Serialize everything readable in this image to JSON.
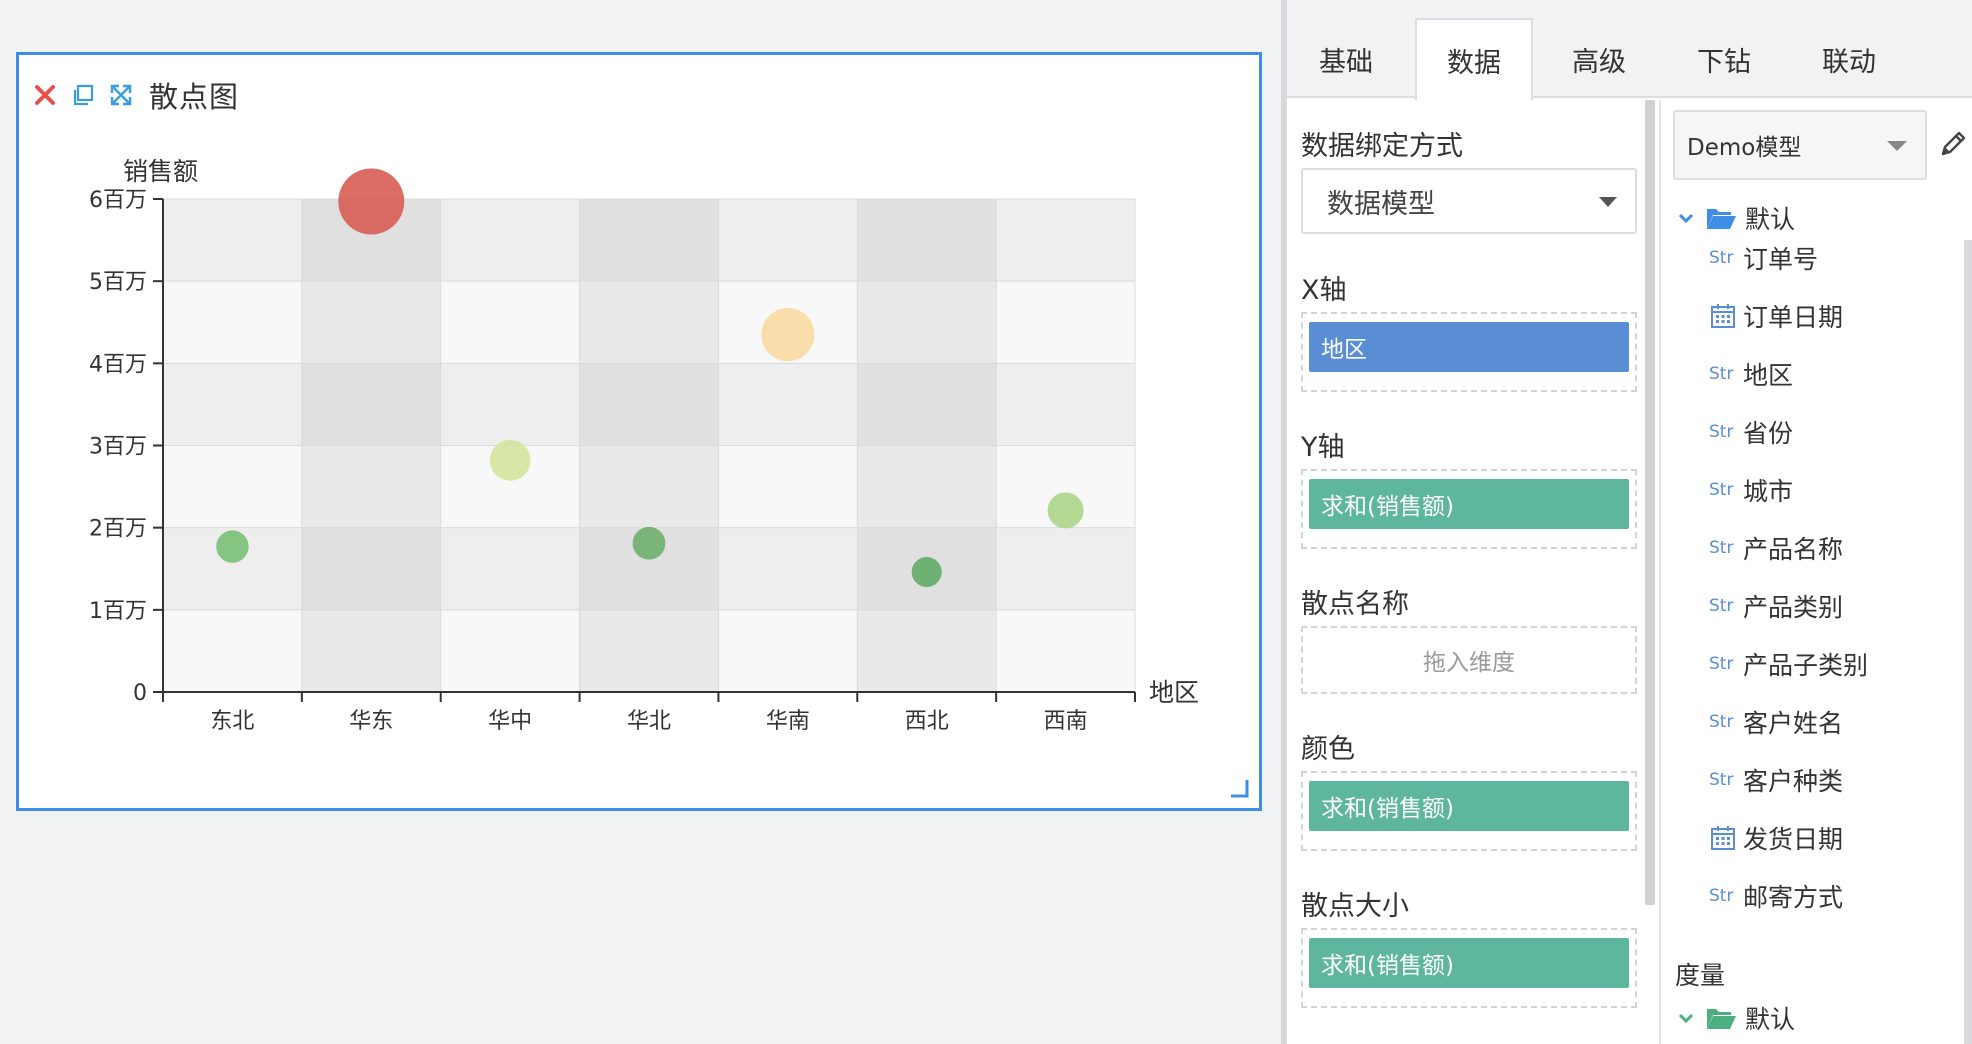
{
  "widget": {
    "title": "散点图",
    "toolbar_icons": [
      "close-icon",
      "copy-icon",
      "expand-icon"
    ]
  },
  "chart_data": {
    "type": "scatter",
    "title": "散点图",
    "xlabel": "地区",
    "ylabel": "销售额",
    "categories": [
      "东北",
      "华东",
      "华中",
      "华北",
      "华南",
      "西北",
      "西南"
    ],
    "values": [
      1770000,
      5970000,
      2820000,
      1810000,
      4350000,
      1460000,
      2210000
    ],
    "colors": [
      "#78be72",
      "#d6594f",
      "#d2e59a",
      "#6aae6a",
      "#f8d9a0",
      "#5ea863",
      "#a8d486"
    ],
    "y_ticks": [
      "0",
      "1百万",
      "2百万",
      "3百万",
      "4百万",
      "5百万",
      "6百万"
    ],
    "ylim": [
      0,
      6000000
    ],
    "size_by_value": true,
    "grid": true
  },
  "tabs": [
    {
      "label": "基础",
      "active": false
    },
    {
      "label": "数据",
      "active": true
    },
    {
      "label": "高级",
      "active": false
    },
    {
      "label": "下钻",
      "active": false
    },
    {
      "label": "联动",
      "active": false
    }
  ],
  "binding": {
    "mode_label": "数据绑定方式",
    "mode_value": "数据模型",
    "x_label": "X轴",
    "x_field": "地区",
    "y_label": "Y轴",
    "y_field": "求和(销售额)",
    "name_label": "散点名称",
    "name_placeholder": "拖入维度",
    "color_label": "颜色",
    "color_field": "求和(销售额)",
    "size_label": "散点大小",
    "size_field": "求和(销售额)"
  },
  "tree": {
    "model": "Demo模型",
    "dim_folder": "默认",
    "dimensions": [
      {
        "type": "Str",
        "label": "订单号"
      },
      {
        "type": "date",
        "label": "订单日期"
      },
      {
        "type": "Str",
        "label": "地区"
      },
      {
        "type": "Str",
        "label": "省份"
      },
      {
        "type": "Str",
        "label": "城市"
      },
      {
        "type": "Str",
        "label": "产品名称"
      },
      {
        "type": "Str",
        "label": "产品类别"
      },
      {
        "type": "Str",
        "label": "产品子类别"
      },
      {
        "type": "Str",
        "label": "客户姓名"
      },
      {
        "type": "Str",
        "label": "客户种类"
      },
      {
        "type": "date",
        "label": "发货日期"
      },
      {
        "type": "Str",
        "label": "邮寄方式"
      }
    ],
    "measure_label": "度量",
    "measure_folder": "默认"
  },
  "colors": {
    "accent": "#3e8ee8",
    "pill_blue": "#5a8ed4",
    "pill_green": "#5fb69f"
  }
}
